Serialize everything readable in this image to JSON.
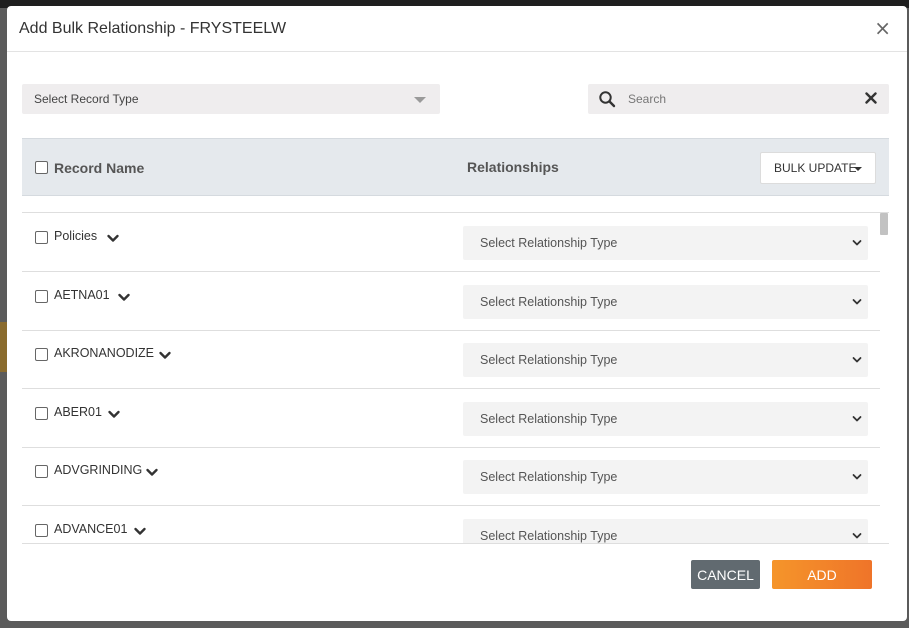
{
  "modal": {
    "title": "Add Bulk Relationship - FRYSTEELW",
    "close_glyph": "×"
  },
  "filters": {
    "record_type_placeholder": "Select Record Type",
    "search_placeholder": "Search"
  },
  "table": {
    "col_record_name": "Record Name",
    "col_relationships": "Relationships",
    "bulk_update_label": "BULK UPDATE",
    "rows": [
      {
        "name": "Policies",
        "relationship": "Select Relationship Type"
      },
      {
        "name": "AETNA01",
        "relationship": "Select Relationship Type"
      },
      {
        "name": "AKRONANODIZE",
        "relationship": "Select Relationship Type"
      },
      {
        "name": "ABER01",
        "relationship": "Select Relationship Type"
      },
      {
        "name": "ADVGRINDING",
        "relationship": "Select Relationship Type"
      },
      {
        "name": "ADVANCE01",
        "relationship": "Select Relationship Type"
      }
    ]
  },
  "footer": {
    "cancel_label": "CANCEL",
    "add_label": "ADD"
  },
  "colors": {
    "add_button": "#f5952a",
    "cancel_button": "#616a70",
    "header_band": "#e5e9ed"
  },
  "icons": {
    "search": "search-icon",
    "clear": "close-icon",
    "expand": "chevron-down-icon",
    "select": "chevron-down-icon"
  }
}
